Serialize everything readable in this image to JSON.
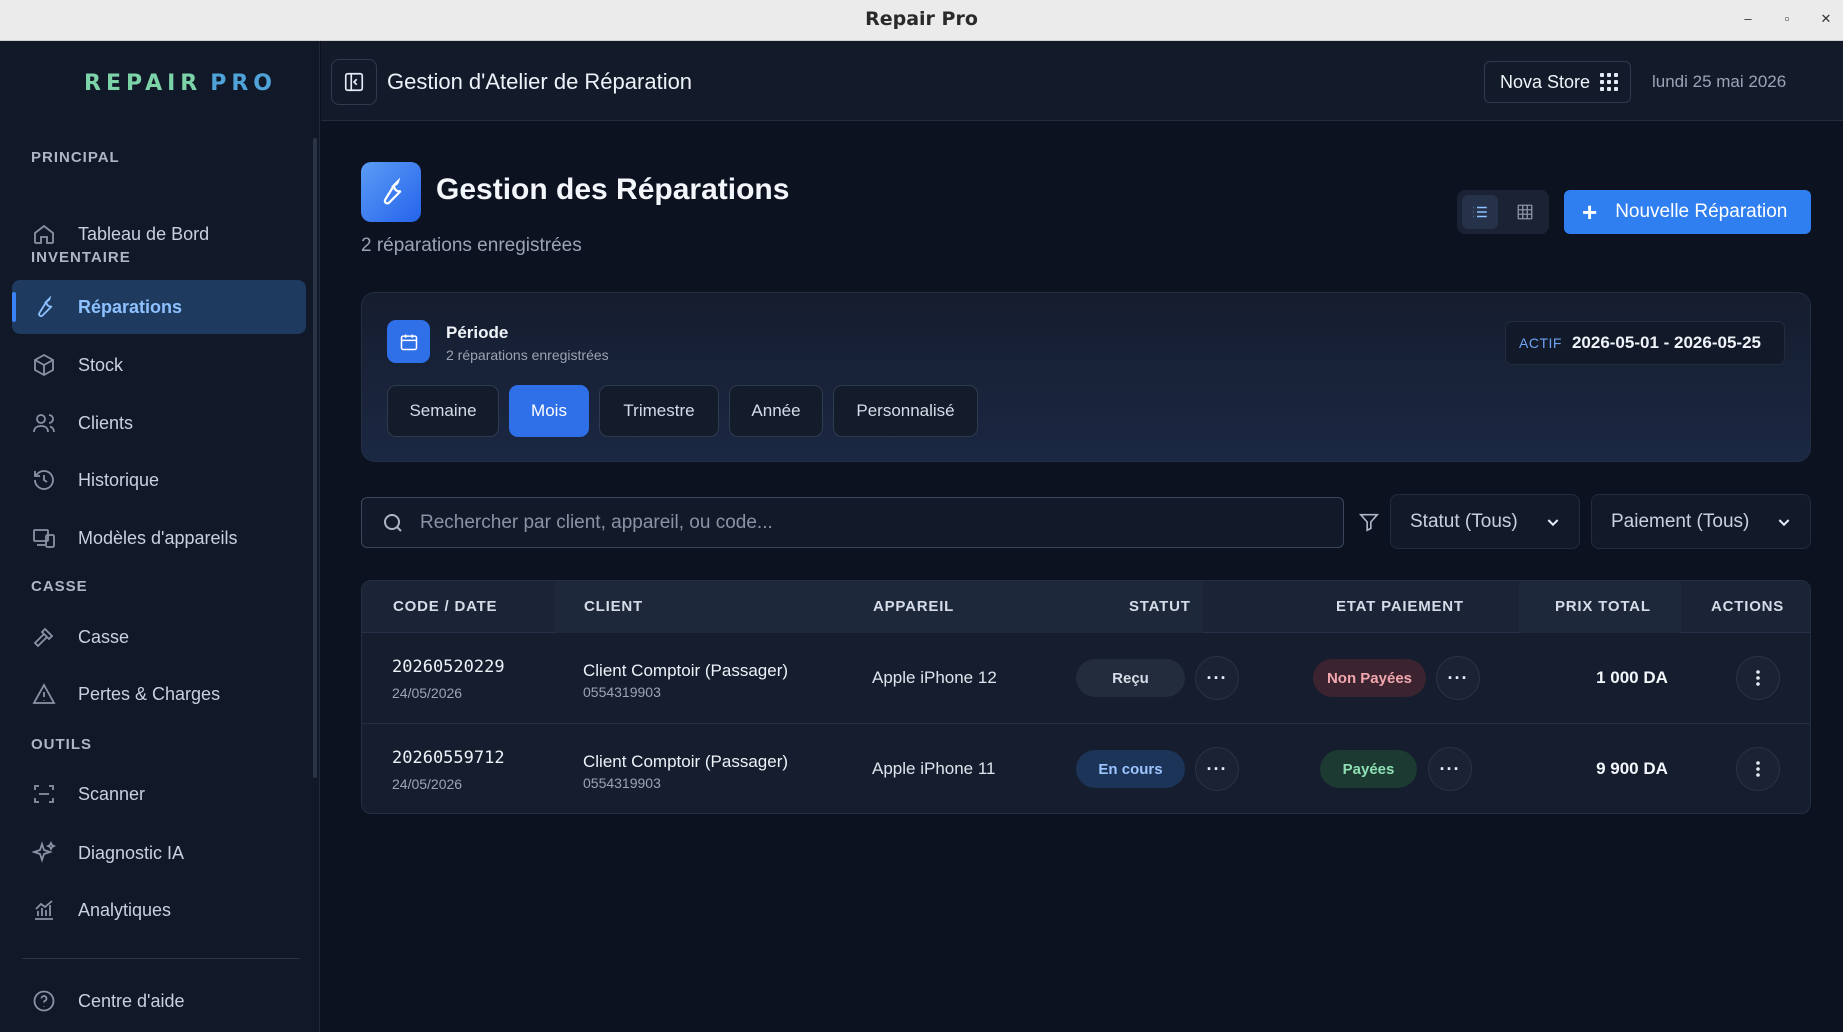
{
  "window": {
    "title": "Repair Pro",
    "controls": [
      "–",
      "▫",
      "✕"
    ]
  },
  "sidebar": {
    "logo": {
      "part1": "REPAIR",
      "part2": "PRO"
    },
    "sections": {
      "principal": "PRINCIPAL",
      "inventaire": "INVENTAIRE",
      "casse": "CASSE",
      "outils": "OUTILS"
    },
    "items": [
      {
        "label": "Tableau de Bord",
        "icon": "home-icon"
      },
      {
        "label": "Réparations",
        "icon": "wrench-icon",
        "active": true
      },
      {
        "label": "Stock",
        "icon": "box-icon"
      },
      {
        "label": "Clients",
        "icon": "users-icon"
      },
      {
        "label": "Historique",
        "icon": "history-icon"
      },
      {
        "label": "Modèles d'appareils",
        "icon": "devices-icon"
      },
      {
        "label": "Casse",
        "icon": "hammer-icon"
      },
      {
        "label": "Pertes & Charges",
        "icon": "warning-icon"
      },
      {
        "label": "Scanner",
        "icon": "scan-icon"
      },
      {
        "label": "Diagnostic IA",
        "icon": "sparkles-icon"
      },
      {
        "label": "Analytiques",
        "icon": "analytics-icon"
      },
      {
        "label": "Centre d'aide",
        "icon": "help-icon"
      }
    ]
  },
  "header": {
    "title": "Gestion d'Atelier de Réparation",
    "store": "Nova Store",
    "date": "lundi 25 mai 2026"
  },
  "main": {
    "title": "Gestion des Réparations",
    "subtitle": "2 réparations enregistrées",
    "new_button": "Nouvelle Réparation",
    "accent": "#2f7ff0"
  },
  "period": {
    "title": "Période",
    "subtitle": "2 réparations enregistrées",
    "active_label": "ACTIF",
    "range": "2026-05-01 - 2026-05-25",
    "options": [
      "Semaine",
      "Mois",
      "Trimestre",
      "Année",
      "Personnalisé"
    ],
    "selected": "Mois"
  },
  "filters": {
    "search_placeholder": "Rechercher par client, appareil, ou code...",
    "status": "Statut (Tous)",
    "payment": "Paiement (Tous)"
  },
  "table": {
    "headers": [
      "CODE / DATE",
      "CLIENT",
      "APPAREIL",
      "STATUT",
      "ETAT PAIEMENT",
      "PRIX TOTAL",
      "ACTIONS"
    ],
    "rows": [
      {
        "code": "20260520229",
        "date": "24/05/2026",
        "client": "Client Comptoir (Passager)",
        "phone": "0554319903",
        "device": "Apple iPhone 12",
        "status": "Reçu",
        "payment": "Non Payées",
        "price": "1 000 DA"
      },
      {
        "code": "20260559712",
        "date": "24/05/2026",
        "client": "Client Comptoir (Passager)",
        "phone": "0554319903",
        "device": "Apple iPhone 11",
        "status": "En cours",
        "payment": "Payées",
        "price": "9 900 DA"
      }
    ]
  }
}
